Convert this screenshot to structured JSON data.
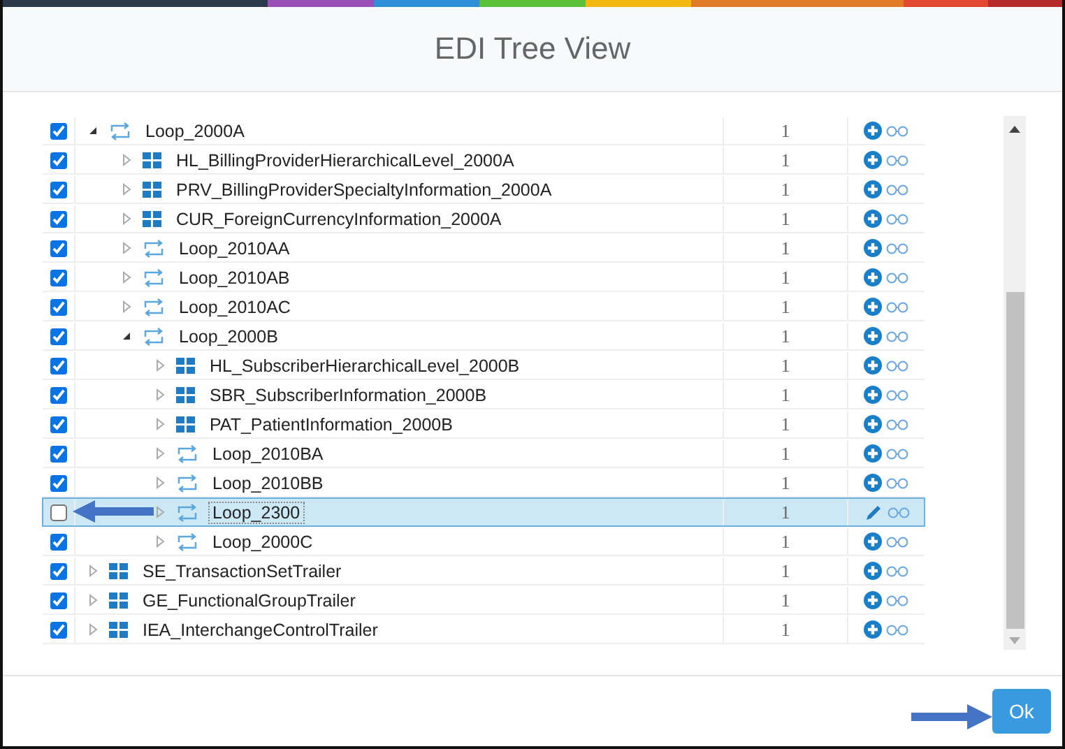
{
  "dialog": {
    "title": "EDI Tree View"
  },
  "tree": [
    {
      "label": "Loop_2000A",
      "kind": "loop",
      "checked": true,
      "expanded": true,
      "selected": false,
      "count": "1",
      "children": [
        {
          "label": "HL_BillingProviderHierarchicalLevel_2000A",
          "kind": "segment",
          "checked": true,
          "expanded": false,
          "selected": false,
          "count": "1"
        },
        {
          "label": "PRV_BillingProviderSpecialtyInformation_2000A",
          "kind": "segment",
          "checked": true,
          "expanded": false,
          "selected": false,
          "count": "1"
        },
        {
          "label": "CUR_ForeignCurrencyInformation_2000A",
          "kind": "segment",
          "checked": true,
          "expanded": false,
          "selected": false,
          "count": "1"
        },
        {
          "label": "Loop_2010AA",
          "kind": "loop",
          "checked": true,
          "expanded": false,
          "selected": false,
          "count": "1"
        },
        {
          "label": "Loop_2010AB",
          "kind": "loop",
          "checked": true,
          "expanded": false,
          "selected": false,
          "count": "1"
        },
        {
          "label": "Loop_2010AC",
          "kind": "loop",
          "checked": true,
          "expanded": false,
          "selected": false,
          "count": "1"
        },
        {
          "label": "Loop_2000B",
          "kind": "loop",
          "checked": true,
          "expanded": true,
          "selected": false,
          "count": "1",
          "children": [
            {
              "label": "HL_SubscriberHierarchicalLevel_2000B",
              "kind": "segment",
              "checked": true,
              "expanded": false,
              "selected": false,
              "count": "1"
            },
            {
              "label": "SBR_SubscriberInformation_2000B",
              "kind": "segment",
              "checked": true,
              "expanded": false,
              "selected": false,
              "count": "1"
            },
            {
              "label": "PAT_PatientInformation_2000B",
              "kind": "segment",
              "checked": true,
              "expanded": false,
              "selected": false,
              "count": "1"
            },
            {
              "label": "Loop_2010BA",
              "kind": "loop",
              "checked": true,
              "expanded": false,
              "selected": false,
              "count": "1"
            },
            {
              "label": "Loop_2010BB",
              "kind": "loop",
              "checked": true,
              "expanded": false,
              "selected": false,
              "count": "1"
            },
            {
              "label": "Loop_2300",
              "kind": "loop",
              "checked": false,
              "expanded": false,
              "selected": true,
              "count": "1"
            },
            {
              "label": "Loop_2000C",
              "kind": "loop",
              "checked": true,
              "expanded": false,
              "selected": false,
              "count": "1"
            }
          ]
        }
      ]
    },
    {
      "label": "SE_TransactionSetTrailer",
      "kind": "segment",
      "checked": true,
      "expanded": false,
      "selected": false,
      "count": "1"
    },
    {
      "label": "GE_FunctionalGroupTrailer",
      "kind": "segment",
      "checked": true,
      "expanded": false,
      "selected": false,
      "count": "1"
    },
    {
      "label": "IEA_InterchangeControlTrailer",
      "kind": "segment",
      "checked": true,
      "expanded": false,
      "selected": false,
      "count": "1"
    }
  ],
  "buttons": [
    {
      "label": "Ok"
    }
  ]
}
